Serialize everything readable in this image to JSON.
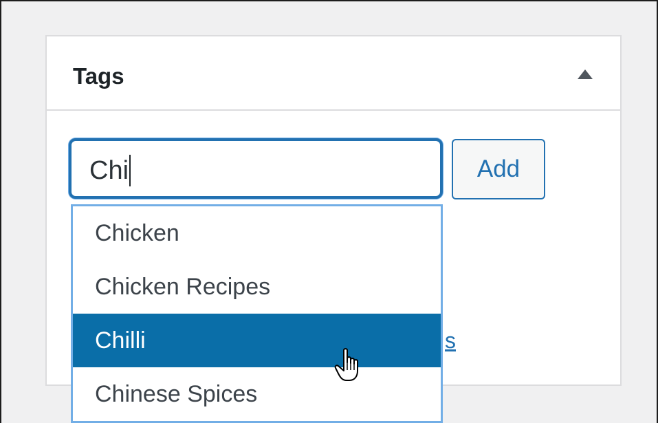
{
  "panel": {
    "title": "Tags"
  },
  "tag_input": {
    "value": "Chi"
  },
  "add_button": {
    "label": "Add"
  },
  "link_fragment": {
    "text": "s"
  },
  "suggestions": [
    {
      "label": "Chicken",
      "active": false
    },
    {
      "label": "Chicken Recipes",
      "active": false
    },
    {
      "label": "Chilli",
      "active": true
    },
    {
      "label": "Chinese Spices",
      "active": false
    }
  ],
  "colors": {
    "accent": "#2271b1",
    "highlight": "#0a6ea8",
    "focus_ring": "#72aee6"
  },
  "icons": {
    "toggle": "triangle-up-icon",
    "cursor": "pointer-hand-icon"
  }
}
